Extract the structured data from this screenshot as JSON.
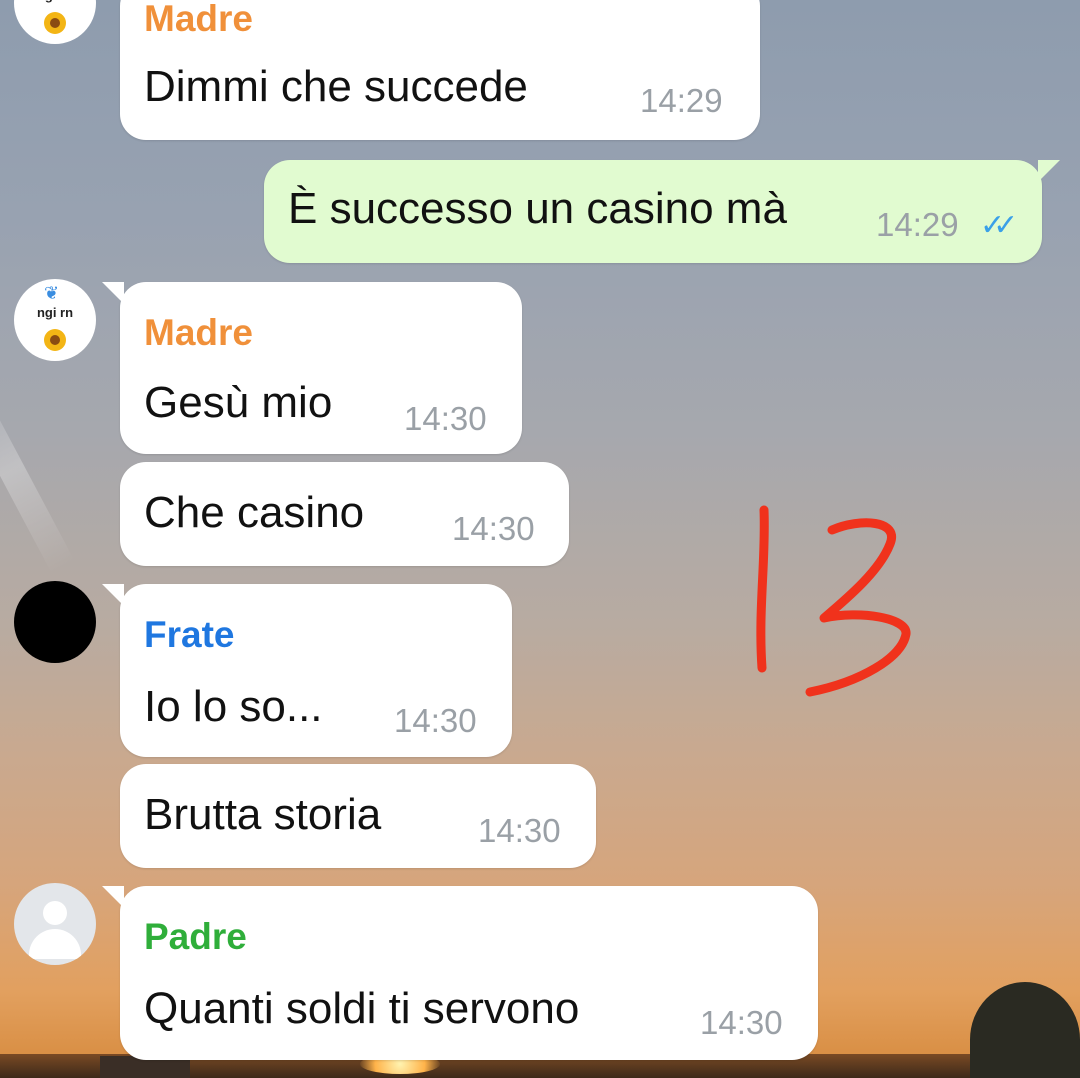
{
  "colors": {
    "madre": "#f0903a",
    "frate": "#1f77e0",
    "padre": "#2fae3a",
    "incoming_bg": "#ffffff",
    "outgoing_bg": "#e1fbd0",
    "ticks": "#3aa0e8",
    "annotation": "#f0321c"
  },
  "avatars": {
    "madre_sticker_text": "ngi rn",
    "madre_icons": [
      "butterfly-icon",
      "sunflower-icon"
    ],
    "frate": "black-circle",
    "padre": "default-person-icon"
  },
  "messages": [
    {
      "sender": "Madre",
      "text": "Dimmi che succede",
      "time": "14:29"
    },
    {
      "text": "È successo un casino mà",
      "time": "14:29",
      "status": "read-double-check"
    },
    {
      "sender": "Madre",
      "text": "Gesù mio",
      "time": "14:30"
    },
    {
      "text": "Che casino",
      "time": "14:30"
    },
    {
      "sender": "Frate",
      "text": "Io lo so...",
      "time": "14:30"
    },
    {
      "text": "Brutta storia",
      "time": "14:30"
    },
    {
      "sender": "Padre",
      "text": "Quanti soldi ti servono",
      "time": "14:30"
    }
  ],
  "annotation": "13"
}
